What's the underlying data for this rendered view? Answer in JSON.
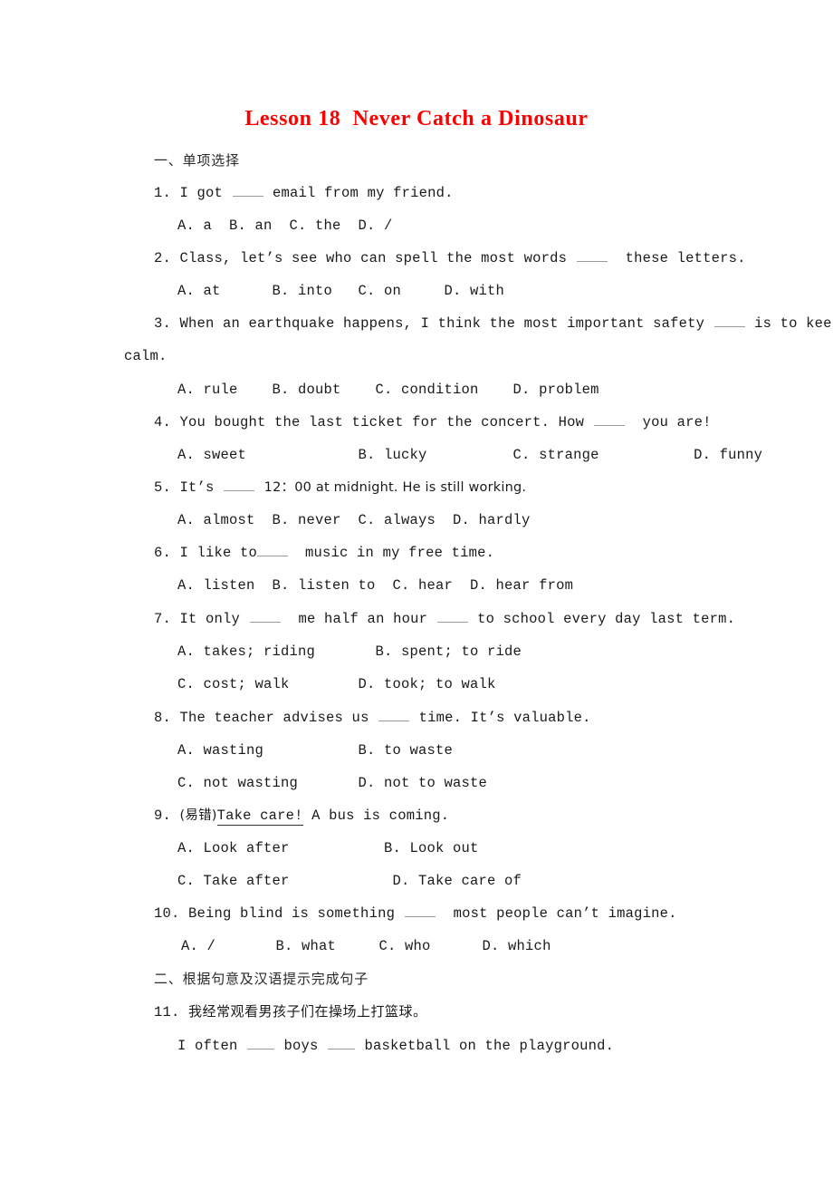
{
  "document": {
    "title": "Lesson 18  Never Catch a Dinosaur",
    "title_color": "#ff0000",
    "background_color": "#ffffff"
  },
  "sections": [
    {
      "id": "section-1",
      "heading": "一、单项选择"
    },
    {
      "id": "section-2",
      "heading": "二、根据句意及汉语提示完成句子"
    }
  ],
  "questions": [
    {
      "number": "1.",
      "stem_before": "I got ",
      "stem_after": " email from my friend.",
      "options_line1": "A. a  B. an  C. the  D. /"
    },
    {
      "number": "2.",
      "stem_before": "Class, let’s see who can spell the most words ",
      "stem_after": "  these letters.",
      "options_line1": "A. at      B. into   C. on     D. with"
    },
    {
      "number": "3.",
      "stem_before": "When an earthquake happens, I think the most important safety ",
      "stem_after": " is to keep",
      "stem_wrap": "calm.",
      "options_line1": "A. rule    B. doubt    C. condition    D. problem"
    },
    {
      "number": "4.",
      "stem_before": "You bought the last ticket for the concert. How ",
      "stem_after": "  you are!",
      "options_line1": "A. sweet             B. lucky          C. strange           D. funny"
    },
    {
      "number": "5.",
      "stem_before": "It’s ",
      "stem_after": "  12：00 at midnight. He is still working.",
      "options_line1": "A. almost  B. never  C. always  D. hardly"
    },
    {
      "number": "6.",
      "stem_before": "I like to",
      "stem_after": "  music in my free time.",
      "options_line1": "A. listen  B. listen to  C. hear  D. hear from"
    },
    {
      "number": "7.",
      "stem_before": "It only ",
      "stem_mid": "  me half an hour ",
      "stem_after": " to school every day last term.",
      "options_line1": "A. takes; riding       B. spent; to ride",
      "options_line2": "C. cost; walk        D. took; to walk"
    },
    {
      "number": "8.",
      "stem_before": "The teacher advises us ",
      "stem_after": " time. It’s valuable.",
      "options_line1": "A. wasting           B. to waste",
      "options_line2": "C. not wasting       D. not to waste"
    },
    {
      "number": "9.",
      "tag": "(易错)",
      "underlined": "Take care!",
      "stem_after": " A bus is coming.",
      "options_line1": "A. Look after           B. Look out",
      "options_line2": "C. Take after            D. Take care of"
    },
    {
      "number": "10.",
      "stem_before": "Being blind is something ",
      "stem_after": "  most people can’t imagine.",
      "options_line1": "A. /       B. what     C. who      D. which"
    },
    {
      "number": "11.",
      "chinese_prompt": "我经常观看男孩子们在操场上打篮球。",
      "answer_before": "I often ",
      "answer_mid": " boys ",
      "answer_after": " basketball on the playground."
    }
  ]
}
